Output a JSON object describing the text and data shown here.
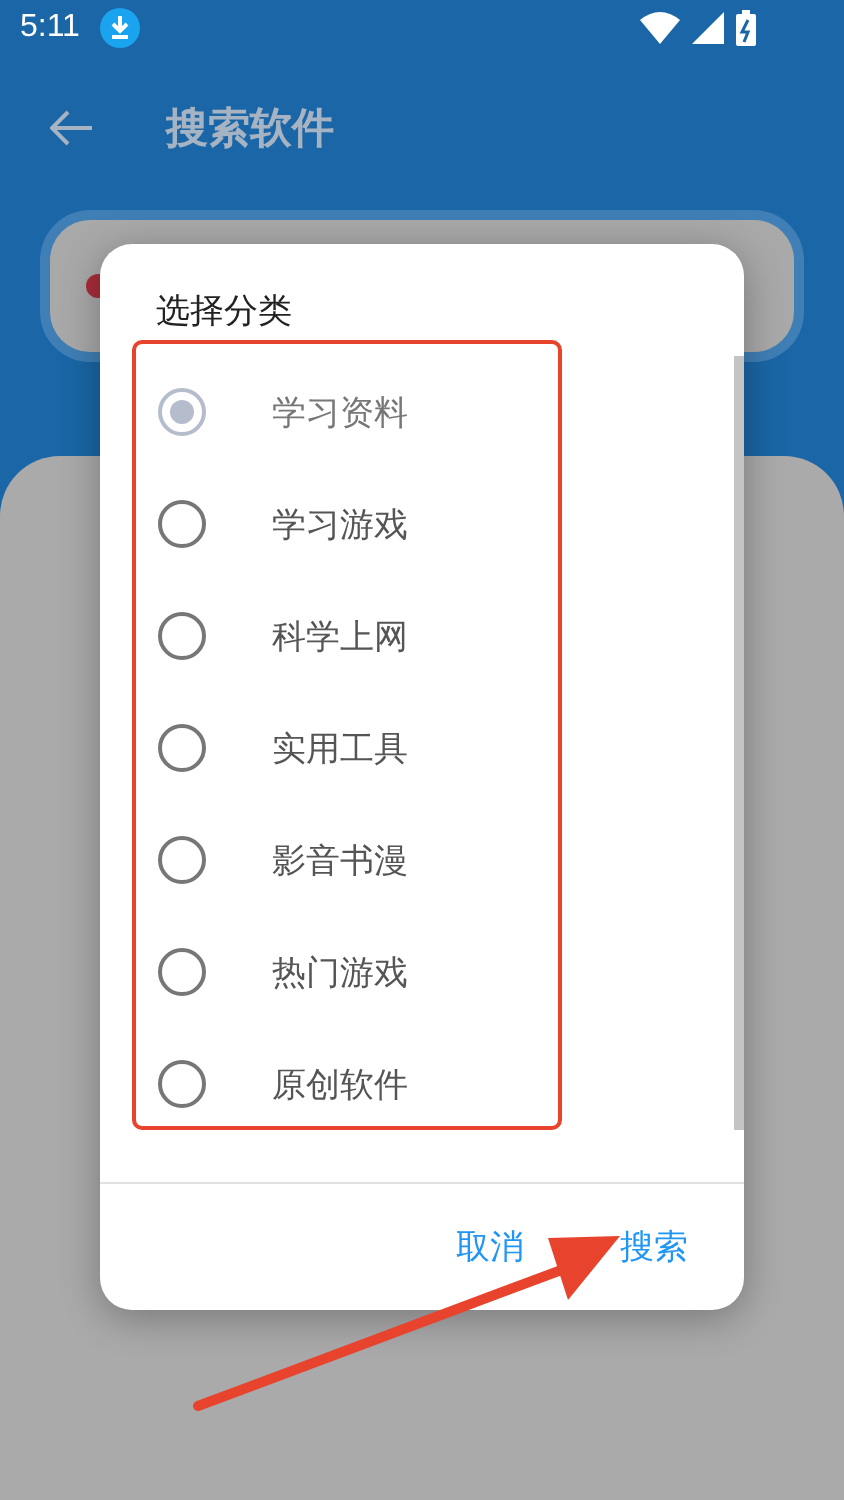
{
  "status_bar": {
    "time": "5:11"
  },
  "app_bar": {
    "title": "搜索软件"
  },
  "dialog": {
    "title": "选择分类",
    "options": [
      {
        "label": "学习资料",
        "selected": true
      },
      {
        "label": "学习游戏",
        "selected": false
      },
      {
        "label": "科学上网",
        "selected": false
      },
      {
        "label": "实用工具",
        "selected": false
      },
      {
        "label": "影音书漫",
        "selected": false
      },
      {
        "label": "热门游戏",
        "selected": false
      },
      {
        "label": "原创软件",
        "selected": false
      }
    ],
    "buttons": [
      "取消",
      "搜索"
    ]
  },
  "annotations": {
    "frame": true,
    "arrow": true
  }
}
